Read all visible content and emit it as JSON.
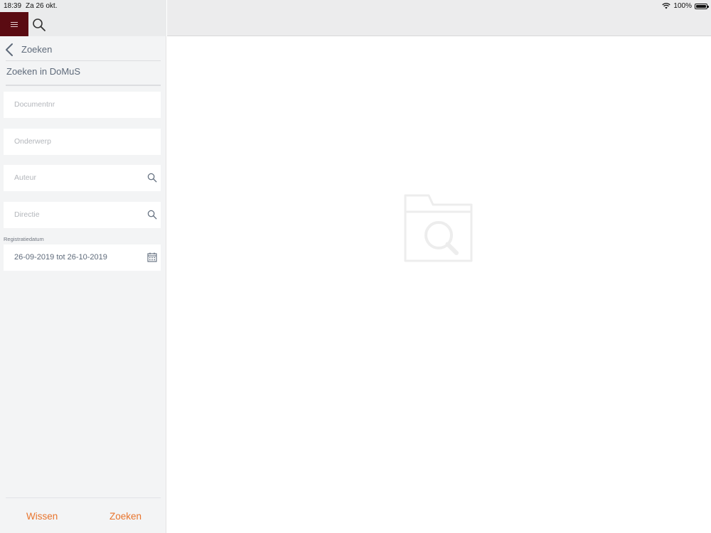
{
  "status_bar": {
    "time": "18:39",
    "date": "Za 26 okt.",
    "battery": "100%",
    "icons": [
      "wifi-icon",
      "battery-icon"
    ]
  },
  "topbar": {
    "menu_icon": "hamburger-menu-icon",
    "search_icon": "search-icon"
  },
  "sidebar": {
    "back_label": "Zoeken",
    "section_title": "Zoeken in DoMuS",
    "fields": [
      {
        "placeholder": "Documentnr",
        "value": ""
      },
      {
        "placeholder": "Onderwerp",
        "value": ""
      },
      {
        "placeholder": "Auteur",
        "value": "",
        "icon": "search-icon"
      },
      {
        "placeholder": "Directie",
        "value": "",
        "icon": "search-icon"
      }
    ],
    "date_field": {
      "label": "Registratiedatum",
      "value": "26-09-2019 tot 26-10-2019",
      "icon": "calendar-icon"
    },
    "buttons": {
      "clear": "Wissen",
      "search": "Zoeken"
    }
  },
  "main": {
    "empty_state_icon": "folder-search-icon"
  },
  "colors": {
    "brand": "#5a0b12",
    "accent": "#e8742c",
    "sidebar_bg": "#f3f4f5",
    "text_muted": "#5e6a7a"
  }
}
